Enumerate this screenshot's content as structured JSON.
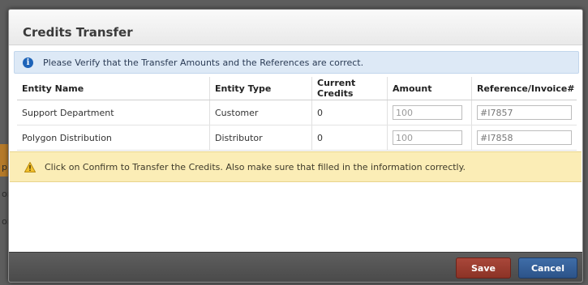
{
  "background": {
    "letters": [
      "p",
      "or",
      "or"
    ]
  },
  "modal": {
    "title": "Credits Transfer",
    "info_message": "Please Verify that the Transfer Amounts and the References are correct.",
    "info_icon": "info-circle-icon",
    "warning_message": "Click on Confirm to Transfer the Credits. Also make sure that filled in the information correctly.",
    "warning_icon": "warning-triangle-icon"
  },
  "table": {
    "headers": {
      "entity_name": "Entity Name",
      "entity_type": "Entity Type",
      "current_credits": "Current Credits",
      "amount": "Amount",
      "reference": "Reference/Invoice#"
    },
    "rows": [
      {
        "entity_name": "Support Department",
        "entity_type": "Customer",
        "current_credits": "0",
        "amount_placeholder": "100",
        "reference_value": "#I7857"
      },
      {
        "entity_name": "Polygon Distribution",
        "entity_type": "Distributor",
        "current_credits": "0",
        "amount_placeholder": "100",
        "reference_value": "#I7858"
      }
    ]
  },
  "footer": {
    "save_label": "Save",
    "cancel_label": "Cancel"
  },
  "colors": {
    "save": "#9c3e31",
    "cancel": "#335f98",
    "info_bg": "#dde9f6",
    "warning_bg": "#fbedb6"
  }
}
